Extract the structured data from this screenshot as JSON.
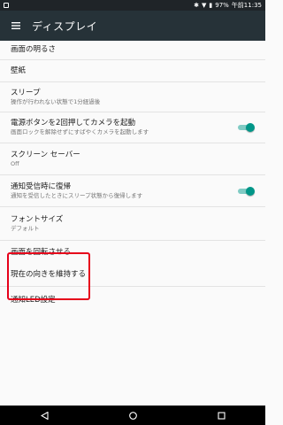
{
  "status_bar": {
    "battery": "97%",
    "time": "午前11:35",
    "icons": [
      "notification-icon",
      "bluetooth-icon",
      "signal-icon",
      "battery-icon"
    ]
  },
  "app_bar": {
    "title": "ディスプレイ",
    "menu_icon": "hamburger-menu-icon"
  },
  "items": [
    {
      "title": "画面の明るさ",
      "subtitle": ""
    },
    {
      "title": "壁紙",
      "subtitle": ""
    },
    {
      "title": "スリープ",
      "subtitle": "操作が行われない状態で1分経過後"
    },
    {
      "title": "電源ボタンを2回押してカメラを起動",
      "subtitle": "画面ロックを解除せずにすばやくカメラを起動します",
      "toggle": true
    },
    {
      "title": "スクリーン セーバー",
      "subtitle": "Off"
    },
    {
      "title": "通知受信時に復帰",
      "subtitle": "通知を受信したときにスリープ状態から復帰します",
      "toggle": true
    },
    {
      "title": "フォントサイズ",
      "subtitle": "デフォルト"
    },
    {
      "title": "画面を回転させる",
      "subtitle": ""
    },
    {
      "title": "現在の向きを維持する",
      "subtitle": ""
    },
    {
      "title": "通知LED設定",
      "subtitle": ""
    }
  ],
  "colors": {
    "app_bar": "#263238",
    "status_bar": "#1f2428",
    "toggle_on": "#009688",
    "highlight": "#e6001a"
  }
}
